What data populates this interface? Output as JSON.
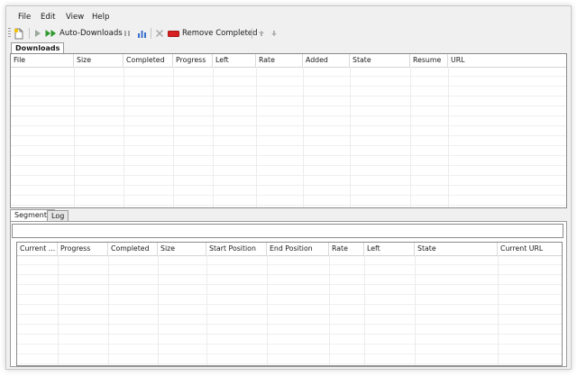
{
  "menu": {
    "items": [
      "File",
      "Edit",
      "View",
      "Help"
    ]
  },
  "toolbar": {
    "auto_downloads_label": "Auto-Downloads",
    "remove_completed_label": "Remove Completed",
    "icons": [
      "new-download-icon",
      "start-icon",
      "auto-downloads-icon",
      "pause-icon",
      "speed-limit-icon",
      "remove-icon",
      "remove-completed-icon",
      "move-up-icon",
      "move-down-icon"
    ]
  },
  "downloads_tab": {
    "label": "Downloads",
    "columns": [
      "File",
      "Size",
      "Completed",
      "Progress",
      "Left",
      "Rate",
      "Added",
      "State",
      "Resume",
      "URL"
    ]
  },
  "bottom_tabs": {
    "segments_label": "Segments",
    "log_label": "Log"
  },
  "segments": {
    "columns": [
      "Current ...",
      "Progress",
      "Completed",
      "Size",
      "Start Position",
      "End Position",
      "Rate",
      "Left",
      "State",
      "Current URL"
    ]
  },
  "colors": {
    "play_green": "#2e9a2e",
    "remove_red": "#d82020",
    "border": "#8a8a8a",
    "window_bg": "#f0f0f0"
  }
}
